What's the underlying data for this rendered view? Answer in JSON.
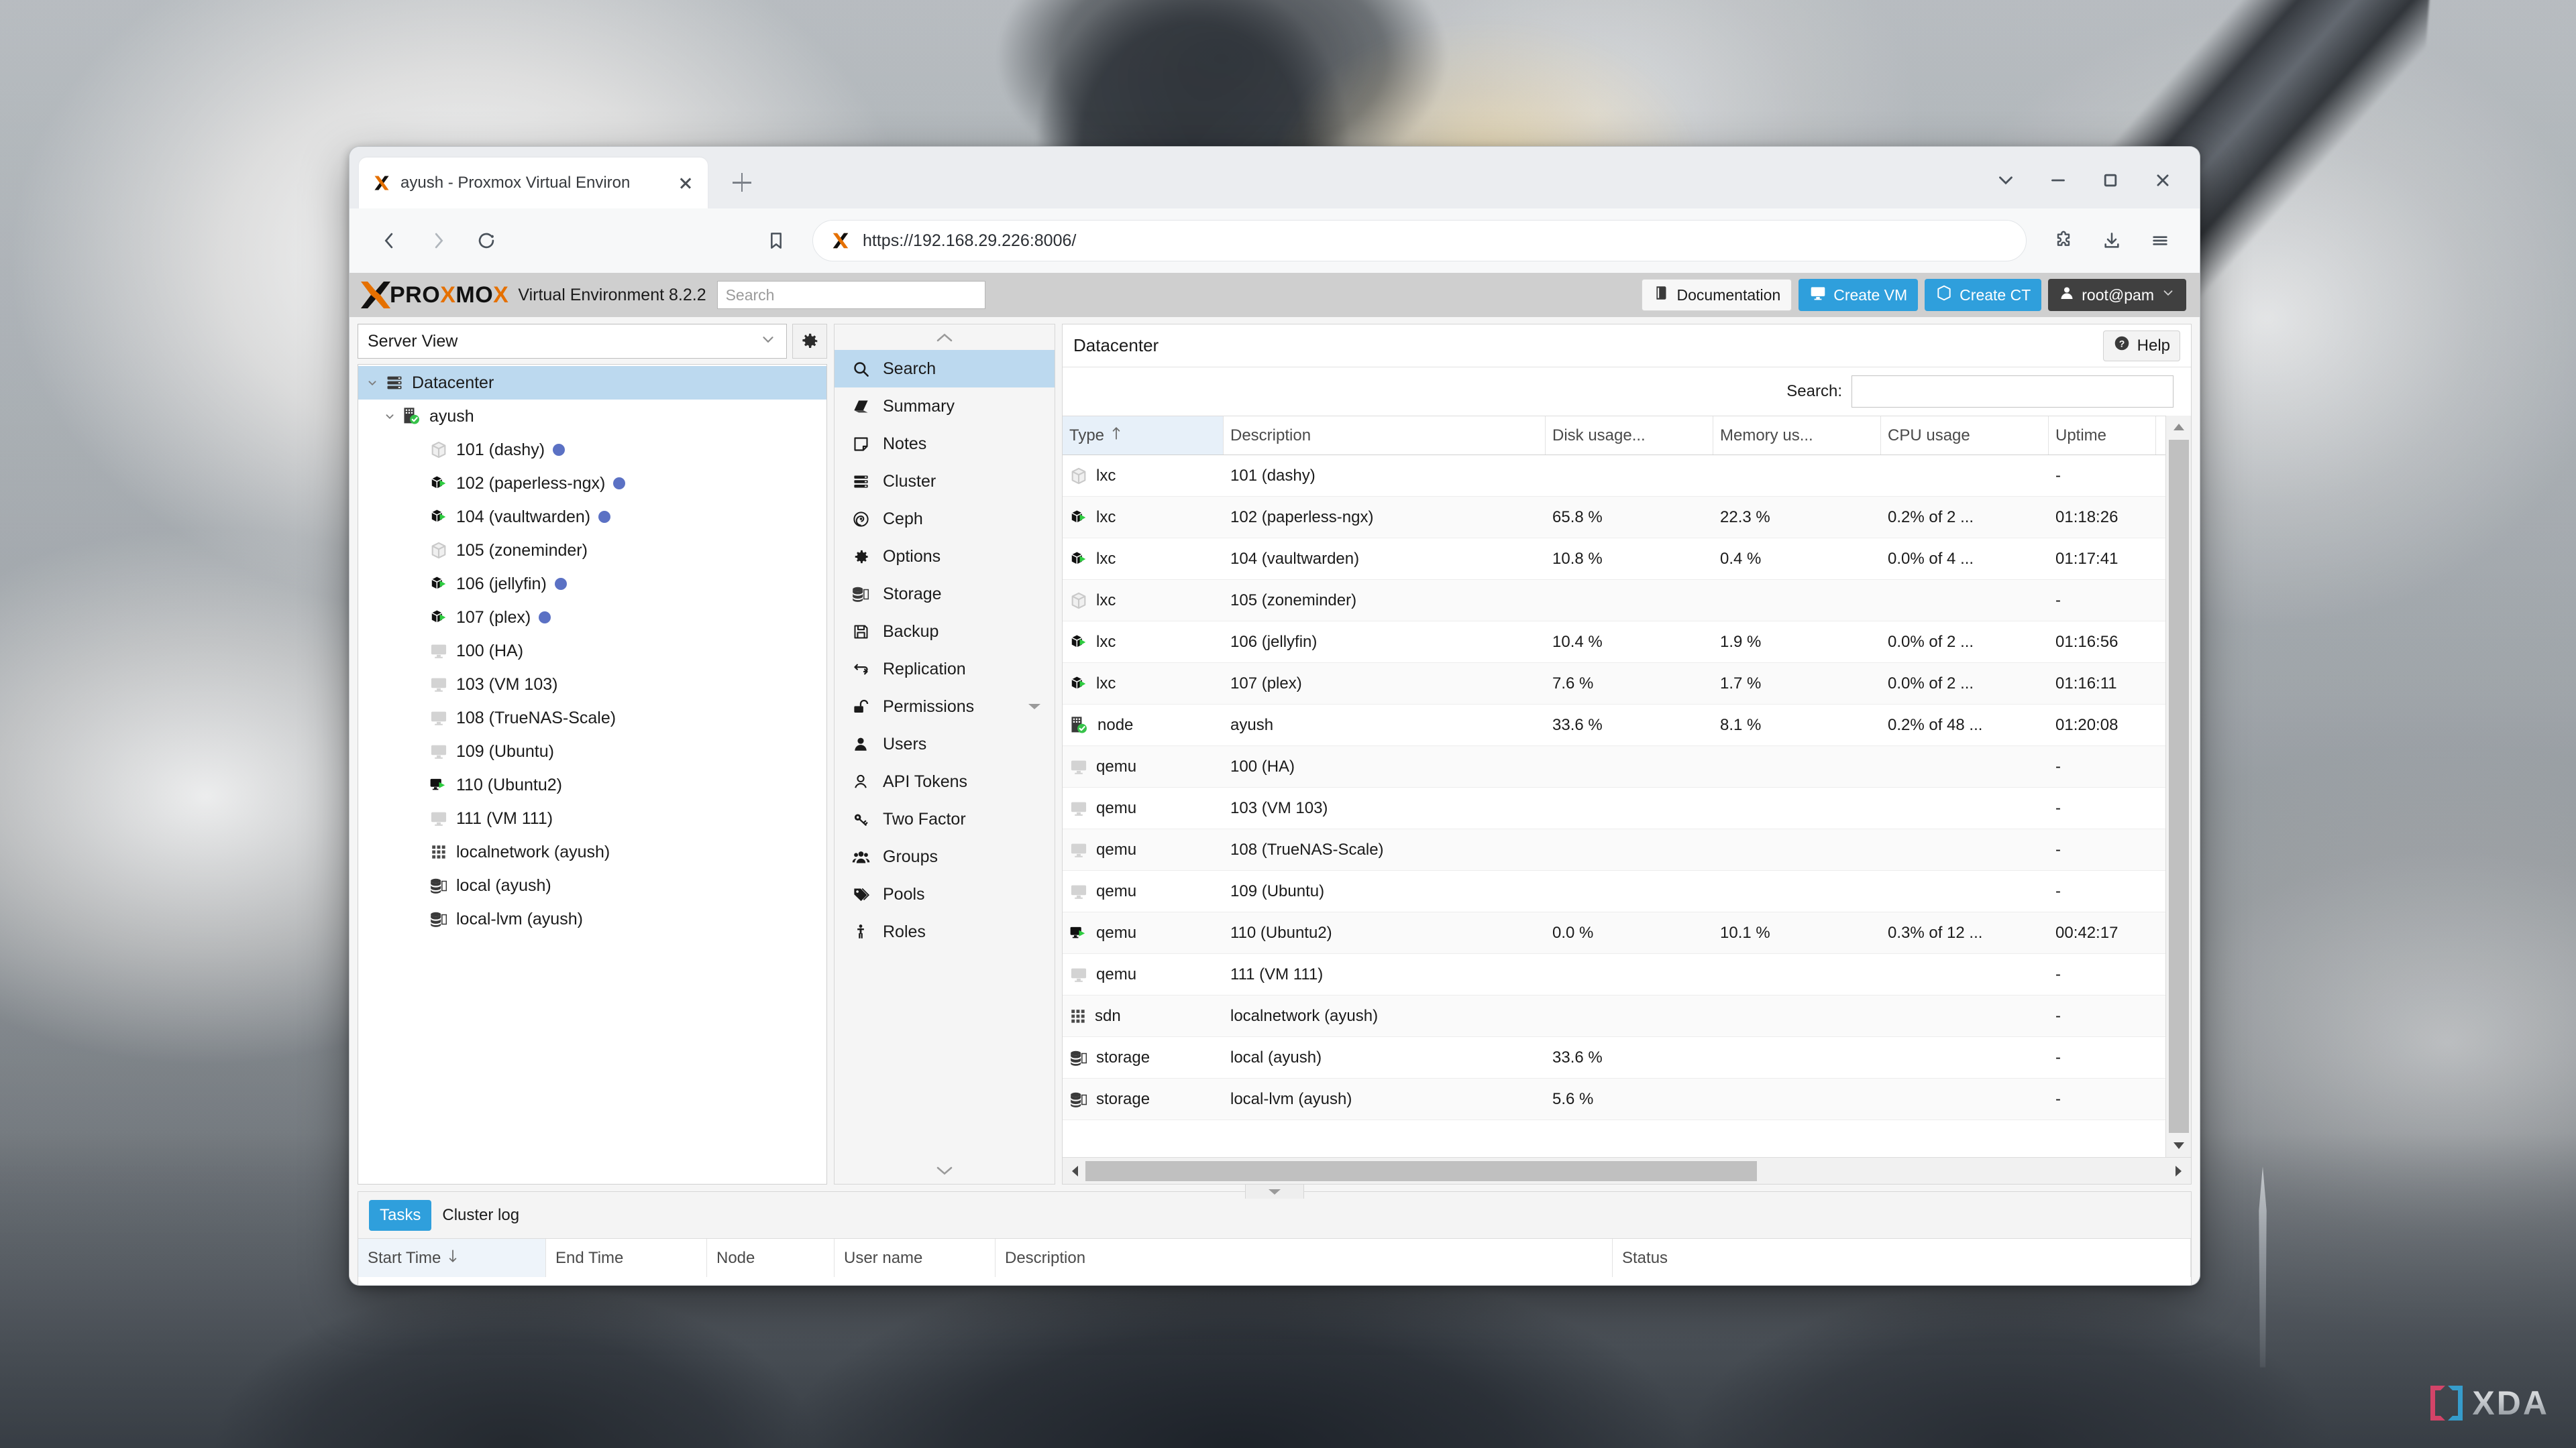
{
  "browser": {
    "tab": {
      "title": "ayush - Proxmox Virtual Environ",
      "favicon": "proxmox-favicon",
      "close_label": "×"
    },
    "new_tab_label": "+",
    "window_controls": {
      "chevron": "chevron-down-icon",
      "minimize": "minimize-icon",
      "maximize": "maximize-icon",
      "close": "close-icon"
    },
    "toolbar": {
      "back": "back-arrow-icon",
      "forward": "forward-arrow-icon",
      "reload": "reload-icon",
      "bookmark": "bookmark-icon",
      "url": "https://192.168.29.226:8006/",
      "extensions": "puzzle-piece-icon",
      "downloads": "download-icon",
      "menu": "hamburger-menu-icon"
    }
  },
  "pve": {
    "logo_text_a": "PRO",
    "logo_text_b": "X",
    "logo_text_c": "MO",
    "logo_text_d": "X",
    "product": "Virtual Environment 8.2.2",
    "search_placeholder": "Search",
    "search_value": "",
    "header_buttons": {
      "documentation": "Documentation",
      "create_vm": "Create VM",
      "create_ct": "Create CT",
      "user": "root@pam"
    },
    "view_selector": {
      "value": "Server View",
      "gear": "gear-icon"
    },
    "tree": [
      {
        "label": "Datacenter",
        "icon": "datacenter-icon",
        "depth": 0,
        "selected": true,
        "expanded": true,
        "dot": false
      },
      {
        "label": "ayush",
        "icon": "node-online-icon",
        "depth": 1,
        "selected": false,
        "expanded": true,
        "dot": false
      },
      {
        "label": "101 (dashy)",
        "icon": "lxc-stopped-icon",
        "depth": 2,
        "selected": false,
        "dot": true
      },
      {
        "label": "102 (paperless-ngx)",
        "icon": "lxc-running-icon",
        "depth": 2,
        "selected": false,
        "dot": true
      },
      {
        "label": "104 (vaultwarden)",
        "icon": "lxc-running-icon",
        "depth": 2,
        "selected": false,
        "dot": true
      },
      {
        "label": "105 (zoneminder)",
        "icon": "lxc-stopped-icon",
        "depth": 2,
        "selected": false,
        "dot": false
      },
      {
        "label": "106 (jellyfin)",
        "icon": "lxc-running-icon",
        "depth": 2,
        "selected": false,
        "dot": true
      },
      {
        "label": "107 (plex)",
        "icon": "lxc-running-icon",
        "depth": 2,
        "selected": false,
        "dot": true
      },
      {
        "label": "100 (HA)",
        "icon": "qemu-stopped-icon",
        "depth": 2,
        "selected": false,
        "dot": false
      },
      {
        "label": "103 (VM 103)",
        "icon": "qemu-stopped-icon",
        "depth": 2,
        "selected": false,
        "dot": false
      },
      {
        "label": "108 (TrueNAS-Scale)",
        "icon": "qemu-stopped-icon",
        "depth": 2,
        "selected": false,
        "dot": false
      },
      {
        "label": "109 (Ubuntu)",
        "icon": "qemu-stopped-icon",
        "depth": 2,
        "selected": false,
        "dot": false
      },
      {
        "label": "110 (Ubuntu2)",
        "icon": "qemu-running-icon",
        "depth": 2,
        "selected": false,
        "dot": false
      },
      {
        "label": "111 (VM 111)",
        "icon": "qemu-stopped-icon",
        "depth": 2,
        "selected": false,
        "dot": false
      },
      {
        "label": "localnetwork (ayush)",
        "icon": "sdn-icon",
        "depth": 2,
        "selected": false,
        "dot": false
      },
      {
        "label": "local (ayush)",
        "icon": "storage-icon",
        "depth": 2,
        "selected": false,
        "dot": false
      },
      {
        "label": "local-lvm (ayush)",
        "icon": "storage-icon",
        "depth": 2,
        "selected": false,
        "dot": false
      }
    ],
    "menu": [
      {
        "label": "Search",
        "icon": "search-icon",
        "active": true
      },
      {
        "label": "Summary",
        "icon": "book-icon",
        "active": false
      },
      {
        "label": "Notes",
        "icon": "note-icon",
        "active": false
      },
      {
        "label": "Cluster",
        "icon": "cluster-icon",
        "active": false
      },
      {
        "label": "Ceph",
        "icon": "ceph-icon",
        "active": false
      },
      {
        "label": "Options",
        "icon": "gear-icon",
        "active": false
      },
      {
        "label": "Storage",
        "icon": "storage-icon",
        "active": false
      },
      {
        "label": "Backup",
        "icon": "floppy-icon",
        "active": false
      },
      {
        "label": "Replication",
        "icon": "replication-icon",
        "active": false
      },
      {
        "label": "Permissions",
        "icon": "unlock-icon",
        "active": false,
        "chevron": true
      },
      {
        "label": "Users",
        "icon": "user-icon",
        "active": false
      },
      {
        "label": "API Tokens",
        "icon": "user-outline-icon",
        "active": false
      },
      {
        "label": "Two Factor",
        "icon": "key-icon",
        "active": false
      },
      {
        "label": "Groups",
        "icon": "group-icon",
        "active": false
      },
      {
        "label": "Pools",
        "icon": "tag-icon",
        "active": false
      },
      {
        "label": "Roles",
        "icon": "person-icon",
        "active": false
      }
    ],
    "content": {
      "title": "Datacenter",
      "help_label": "Help",
      "help_icon": "question-circle-icon",
      "search_label": "Search:",
      "search_value": "",
      "columns": [
        "Type",
        "Description",
        "Disk usage...",
        "Memory us...",
        "CPU usage",
        "Uptime"
      ],
      "sort_column": "Type",
      "sort_dir": "asc",
      "rows": [
        {
          "icon": "lxc-stopped-icon",
          "type": "lxc",
          "description": "101 (dashy)",
          "disk": "",
          "memory": "",
          "cpu": "",
          "uptime": "-"
        },
        {
          "icon": "lxc-running-icon",
          "type": "lxc",
          "description": "102 (paperless-ngx)",
          "disk": "65.8 %",
          "memory": "22.3 %",
          "cpu": "0.2% of 2 ...",
          "uptime": "01:18:26"
        },
        {
          "icon": "lxc-running-icon",
          "type": "lxc",
          "description": "104 (vaultwarden)",
          "disk": "10.8 %",
          "memory": "0.4 %",
          "cpu": "0.0% of 4 ...",
          "uptime": "01:17:41"
        },
        {
          "icon": "lxc-stopped-icon",
          "type": "lxc",
          "description": "105 (zoneminder)",
          "disk": "",
          "memory": "",
          "cpu": "",
          "uptime": "-"
        },
        {
          "icon": "lxc-running-icon",
          "type": "lxc",
          "description": "106 (jellyfin)",
          "disk": "10.4 %",
          "memory": "1.9 %",
          "cpu": "0.0% of 2 ...",
          "uptime": "01:16:56"
        },
        {
          "icon": "lxc-running-icon",
          "type": "lxc",
          "description": "107 (plex)",
          "disk": "7.6 %",
          "memory": "1.7 %",
          "cpu": "0.0% of 2 ...",
          "uptime": "01:16:11"
        },
        {
          "icon": "node-online-icon",
          "type": "node",
          "description": "ayush",
          "disk": "33.6 %",
          "memory": "8.1 %",
          "cpu": "0.2% of 48 ...",
          "uptime": "01:20:08"
        },
        {
          "icon": "qemu-stopped-icon",
          "type": "qemu",
          "description": "100 (HA)",
          "disk": "",
          "memory": "",
          "cpu": "",
          "uptime": "-"
        },
        {
          "icon": "qemu-stopped-icon",
          "type": "qemu",
          "description": "103 (VM 103)",
          "disk": "",
          "memory": "",
          "cpu": "",
          "uptime": "-"
        },
        {
          "icon": "qemu-stopped-icon",
          "type": "qemu",
          "description": "108 (TrueNAS-Scale)",
          "disk": "",
          "memory": "",
          "cpu": "",
          "uptime": "-"
        },
        {
          "icon": "qemu-stopped-icon",
          "type": "qemu",
          "description": "109 (Ubuntu)",
          "disk": "",
          "memory": "",
          "cpu": "",
          "uptime": "-"
        },
        {
          "icon": "qemu-running-icon",
          "type": "qemu",
          "description": "110 (Ubuntu2)",
          "disk": "0.0 %",
          "memory": "10.1 %",
          "cpu": "0.3% of 12 ...",
          "uptime": "00:42:17"
        },
        {
          "icon": "qemu-stopped-icon",
          "type": "qemu",
          "description": "111 (VM 111)",
          "disk": "",
          "memory": "",
          "cpu": "",
          "uptime": "-"
        },
        {
          "icon": "sdn-icon",
          "type": "sdn",
          "description": "localnetwork (ayush)",
          "disk": "",
          "memory": "",
          "cpu": "",
          "uptime": "-"
        },
        {
          "icon": "storage-icon",
          "type": "storage",
          "description": "local (ayush)",
          "disk": "33.6 %",
          "memory": "",
          "cpu": "",
          "uptime": "-"
        },
        {
          "icon": "storage-icon",
          "type": "storage",
          "description": "local-lvm (ayush)",
          "disk": "5.6 %",
          "memory": "",
          "cpu": "",
          "uptime": "-"
        }
      ]
    },
    "tasks": {
      "tabs": [
        {
          "label": "Tasks",
          "active": true
        },
        {
          "label": "Cluster log",
          "active": false
        }
      ],
      "columns": [
        "Start Time",
        "End Time",
        "Node",
        "User name",
        "Description",
        "Status"
      ],
      "sort_column": "Start Time",
      "sort_dir": "desc"
    }
  },
  "watermark": {
    "text": "XDA",
    "bracket_left_color": "#e8446d",
    "bracket_right_color": "#35a8dd"
  },
  "colors": {
    "accent_orange": "#e57000",
    "accent_blue": "#2f9fdc",
    "selection_blue": "#bcd9ef",
    "dark_button": "#404040"
  }
}
